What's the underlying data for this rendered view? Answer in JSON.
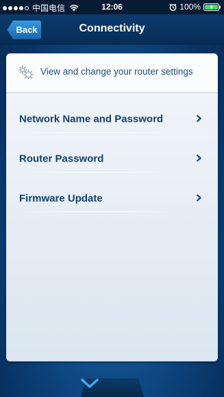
{
  "status_bar": {
    "carrier": "中国电信",
    "time": "12:06",
    "battery": "100%"
  },
  "nav": {
    "back_label": "Back",
    "title": "Connectivity"
  },
  "card": {
    "header_icon": "gear-icon",
    "header_text": "View and change your router settings",
    "items": [
      {
        "label": "Network Name and Password",
        "icon": "chevron-right-icon"
      },
      {
        "label": "Router Password",
        "icon": "chevron-right-icon"
      },
      {
        "label": "Firmware Update",
        "icon": "chevron-right-icon"
      }
    ]
  },
  "bottom_tab": {
    "icon": "chevron-down-icon"
  },
  "colors": {
    "accent": "#143f6e",
    "nav_background": "#0b3b6e",
    "back_button": "#1c7cc4"
  }
}
